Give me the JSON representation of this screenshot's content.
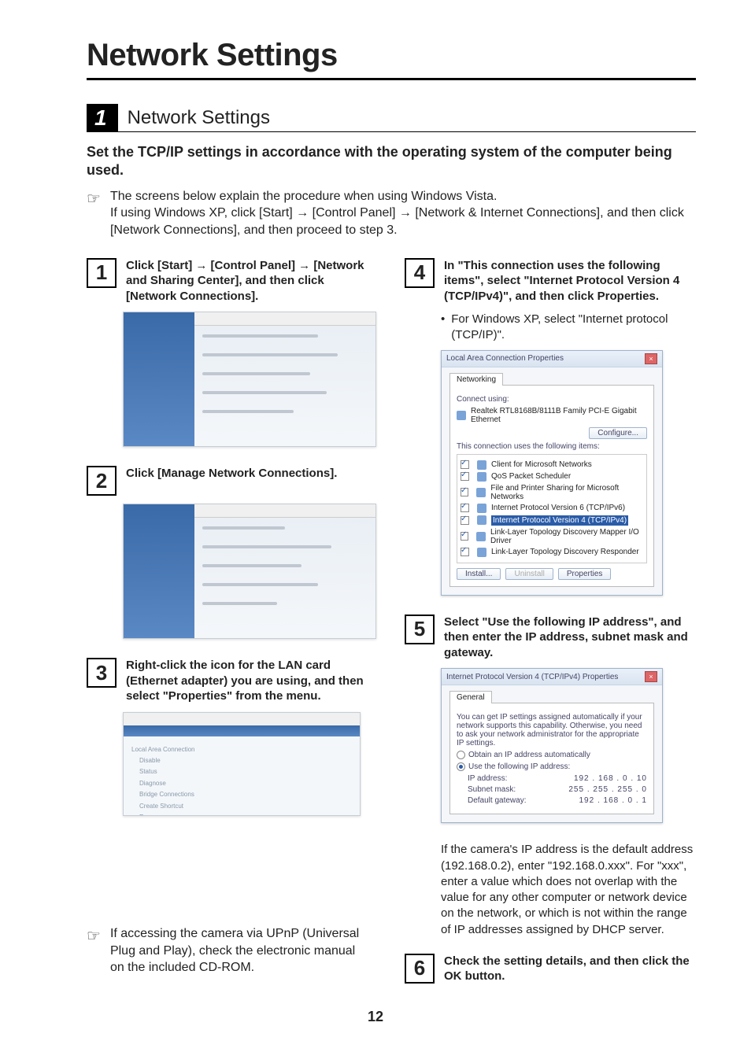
{
  "title": "Network Settings",
  "section": {
    "num": "1",
    "label": "Network Settings"
  },
  "subtitle": "Set the TCP/IP settings in accordance with the operating system of the computer being used.",
  "intro_note": "The screens below explain the procedure when using Windows Vista.\nIf using Windows XP, click [Start] → [Control Panel] → [Network & Internet Connections], and then click [Network Connections], and then proceed to step 3.",
  "steps": {
    "s1": "Click [Start] → [Control Panel] → [Network and Sharing Center], and then click [Network Connections].",
    "s2": "Click [Manage Network Connections].",
    "s3": "Right-click the icon for the LAN card (Ethernet adapter) you are using, and then select \"Properties\" from the menu.",
    "s4": "In \"This connection uses the following items\", select \"Internet Protocol Version 4 (TCP/IPv4)\", and then click Properties.",
    "s4_bullet": "For Windows XP, select \"Internet protocol (TCP/IP)\".",
    "s5": "Select \"Use the following IP address\", and then enter the IP address, subnet mask and gateway.",
    "s5_para": "If the camera's IP address is the default address (192.168.0.2), enter \"192.168.0.xxx\". For \"xxx\", enter a value which does not overlap with the value for any other computer or network device on the network, or which is not within the range of IP addresses assigned by DHCP server.",
    "s6": "Check the setting details, and then click the OK button."
  },
  "upnp_note": "If accessing the camera via UPnP (Universal Plug and Play), check the electronic manual on the included CD-ROM.",
  "dialog4": {
    "title": "Local Area Connection Properties",
    "tab": "Networking",
    "connect_label": "Connect using:",
    "adapter": "Realtek RTL8168B/8111B Family PCI-E Gigabit Ethernet",
    "configure": "Configure...",
    "uses_label": "This connection uses the following items:",
    "items": [
      "Client for Microsoft Networks",
      "QoS Packet Scheduler",
      "File and Printer Sharing for Microsoft Networks",
      "Internet Protocol Version 6 (TCP/IPv6)",
      "Internet Protocol Version 4 (TCP/IPv4)",
      "Link-Layer Topology Discovery Mapper I/O Driver",
      "Link-Layer Topology Discovery Responder"
    ],
    "btn_install": "Install...",
    "btn_uninstall": "Uninstall",
    "btn_props": "Properties"
  },
  "dialog5": {
    "title": "Internet Protocol Version 4 (TCP/IPv4) Properties",
    "tab": "General",
    "blurb": "You can get IP settings assigned automatically if your network supports this capability. Otherwise, you need to ask your network administrator for the appropriate IP settings.",
    "r1": "Obtain an IP address automatically",
    "r2": "Use the following IP address:",
    "ip_label": "IP address:",
    "ip_val": "192 . 168 .  0  . 10",
    "mask_label": "Subnet mask:",
    "mask_val": "255 . 255 . 255 .  0",
    "gw_label": "Default gateway:",
    "gw_val": "192 . 168 .  0  .  1"
  },
  "page_number": "12"
}
